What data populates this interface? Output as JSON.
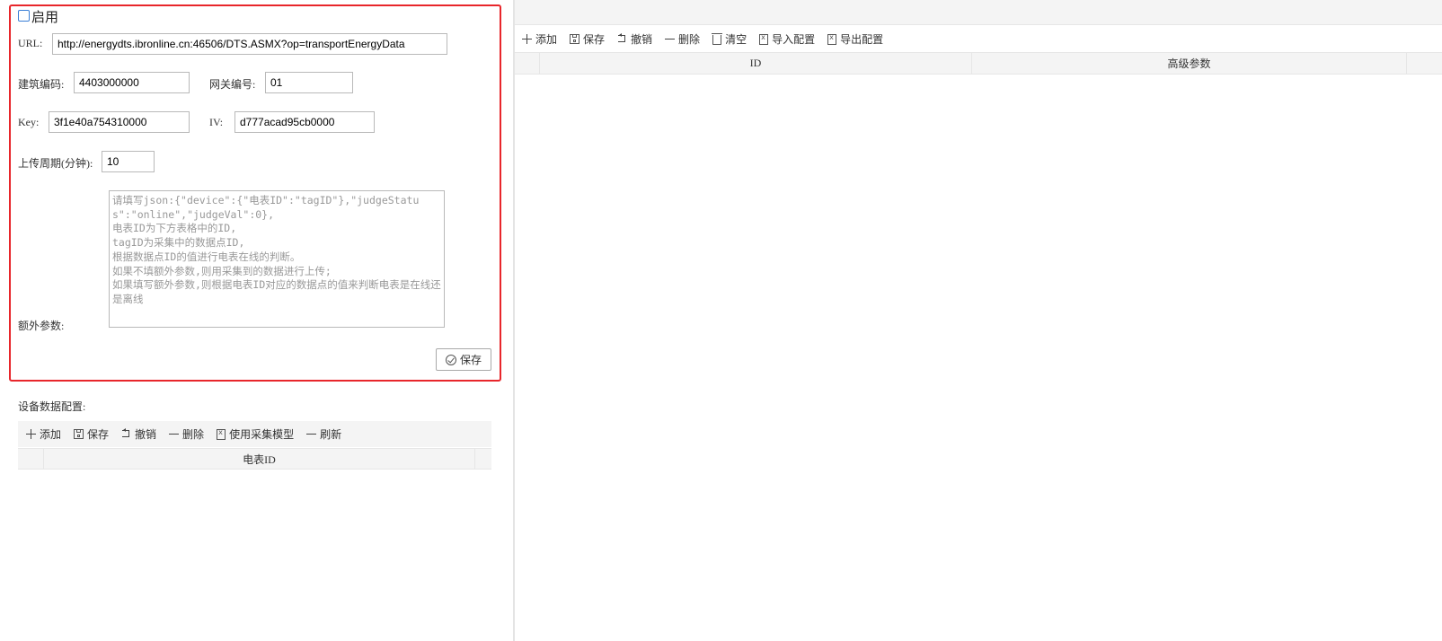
{
  "config": {
    "enable_label": "启用",
    "enabled": false,
    "url_label": "URL:",
    "url_value": "http://energydts.ibronline.cn:46506/DTS.ASMX?op=transportEnergyData",
    "building_code_label": "建筑编码:",
    "building_code_value": "4403000000",
    "gateway_no_label": "网关编号:",
    "gateway_no_value": "01",
    "key_label": "Key:",
    "key_value": "3f1e40a754310000",
    "iv_label": "IV:",
    "iv_value": "d777acad95cb0000",
    "upload_period_label": "上传周期(分钟):",
    "upload_period_value": "10",
    "extra_params_label": "额外参数:",
    "extra_params_placeholder": "请填写json:{\"device\":{\"电表ID\":\"tagID\"},\"judgeStatus\":\"online\",\"judgeVal\":0},\n电表ID为下方表格中的ID,\ntagID为采集中的数据点ID,\n根据数据点ID的值进行电表在线的判断。\n如果不填额外参数,则用采集到的数据进行上传;\n如果填写额外参数,则根据电表ID对应的数据点的值来判断电表是在线还是离线",
    "save_label": "保存",
    "border_color": "#e8262b"
  },
  "device_config": {
    "title": "设备数据配置:",
    "toolbar": {
      "add": "添加",
      "save": "保存",
      "undo": "撤销",
      "delete": "删除",
      "use_model": "使用采集模型",
      "refresh": "刷新"
    },
    "columns": [
      "电表ID"
    ]
  },
  "right_panel": {
    "toolbar": {
      "add": "添加",
      "save": "保存",
      "undo": "撤销",
      "delete": "删除",
      "clear": "清空",
      "import": "导入配置",
      "export": "导出配置"
    },
    "columns": [
      "ID",
      "高级参数"
    ]
  }
}
